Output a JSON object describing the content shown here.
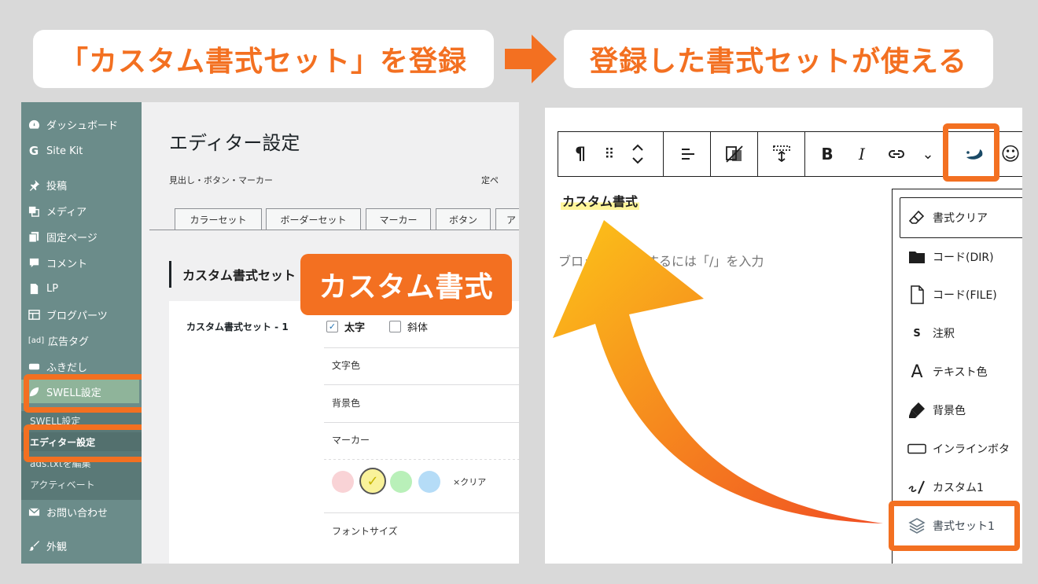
{
  "banners": {
    "left": "「カスタム書式セット」を登録",
    "right": "登録した書式セットが使える"
  },
  "wp_sidebar": {
    "items": [
      {
        "label": "ダッシュボード",
        "icon": "dashboard-icon"
      },
      {
        "label": "Site Kit",
        "icon": "google-icon"
      },
      {
        "label": "投稿",
        "icon": "pin-icon"
      },
      {
        "label": "メディア",
        "icon": "media-icon"
      },
      {
        "label": "固定ページ",
        "icon": "pages-icon"
      },
      {
        "label": "コメント",
        "icon": "comment-icon"
      },
      {
        "label": "LP",
        "icon": "document-icon"
      },
      {
        "label": "ブログパーツ",
        "icon": "grid-icon"
      },
      {
        "label": "広告タグ",
        "icon": "ad-icon"
      },
      {
        "label": "ふきだし",
        "icon": "speech-icon"
      },
      {
        "label": "SWELL設定",
        "icon": "swell-leaf-icon"
      },
      {
        "label": "お問い合わせ",
        "icon": "mail-icon"
      },
      {
        "label": "外観",
        "icon": "brush-icon"
      }
    ],
    "ad_icon_text": "[ad]",
    "submenu": [
      "SWELL設定",
      "エディター設定",
      "ads.txtを編集",
      "アクティベート"
    ]
  },
  "wp_main": {
    "title": "エディター設定",
    "description": "見出し・ボタン・マーカー",
    "description_tail": "定ペ",
    "tabs": [
      "カラーセット",
      "ボーダーセット",
      "マーカー",
      "ボタン",
      "ア"
    ],
    "section_title": "カスタム書式セット",
    "row_label": "カスタム書式セット - 1",
    "checkboxes": [
      {
        "label": "太字",
        "checked": true,
        "check_mark": "✓"
      },
      {
        "label": "斜体",
        "checked": false,
        "check_mark": ""
      }
    ],
    "fields": [
      "文字色",
      "背景色",
      "マーカー",
      "フォントサイズ"
    ],
    "marker_colors": [
      "#f9d3d6",
      "#f9f29a",
      "#b9f0b9",
      "#b5dcf7"
    ],
    "marker_check": "✓",
    "clear_label": "×クリア",
    "badge_label": "カスタム書式"
  },
  "editor": {
    "toolbar": {
      "paragraph": "¶",
      "drag": "⠿",
      "bold": "B",
      "italic": "I",
      "more": "⌄",
      "emoji": "☺"
    },
    "sample_text": "カスタム書式",
    "placeholder": "ブロックを選択するには「/」を入力",
    "dropdown": [
      {
        "label": "書式クリア",
        "icon": "eraser-icon"
      },
      {
        "label": "コード(DIR)",
        "icon": "folder-icon"
      },
      {
        "label": "コード(FILE)",
        "icon": "file-icon"
      },
      {
        "label": "注釈",
        "icon": "s-icon"
      },
      {
        "label": "テキスト色",
        "icon": "text-color-icon"
      },
      {
        "label": "背景色",
        "icon": "highlighter-icon"
      },
      {
        "label": "インラインボタ",
        "icon": "inline-button-icon"
      },
      {
        "label": "カスタム1",
        "icon": "pen-icon"
      },
      {
        "label": "書式セット1",
        "icon": "layers-icon"
      }
    ],
    "dropdown_glyphs": {
      "s_icon": "S",
      "text_color_icon": "A"
    }
  },
  "colors": {
    "accent": "#f37021",
    "sidebar": "#6b8c8a",
    "marker": "#fff59a"
  }
}
